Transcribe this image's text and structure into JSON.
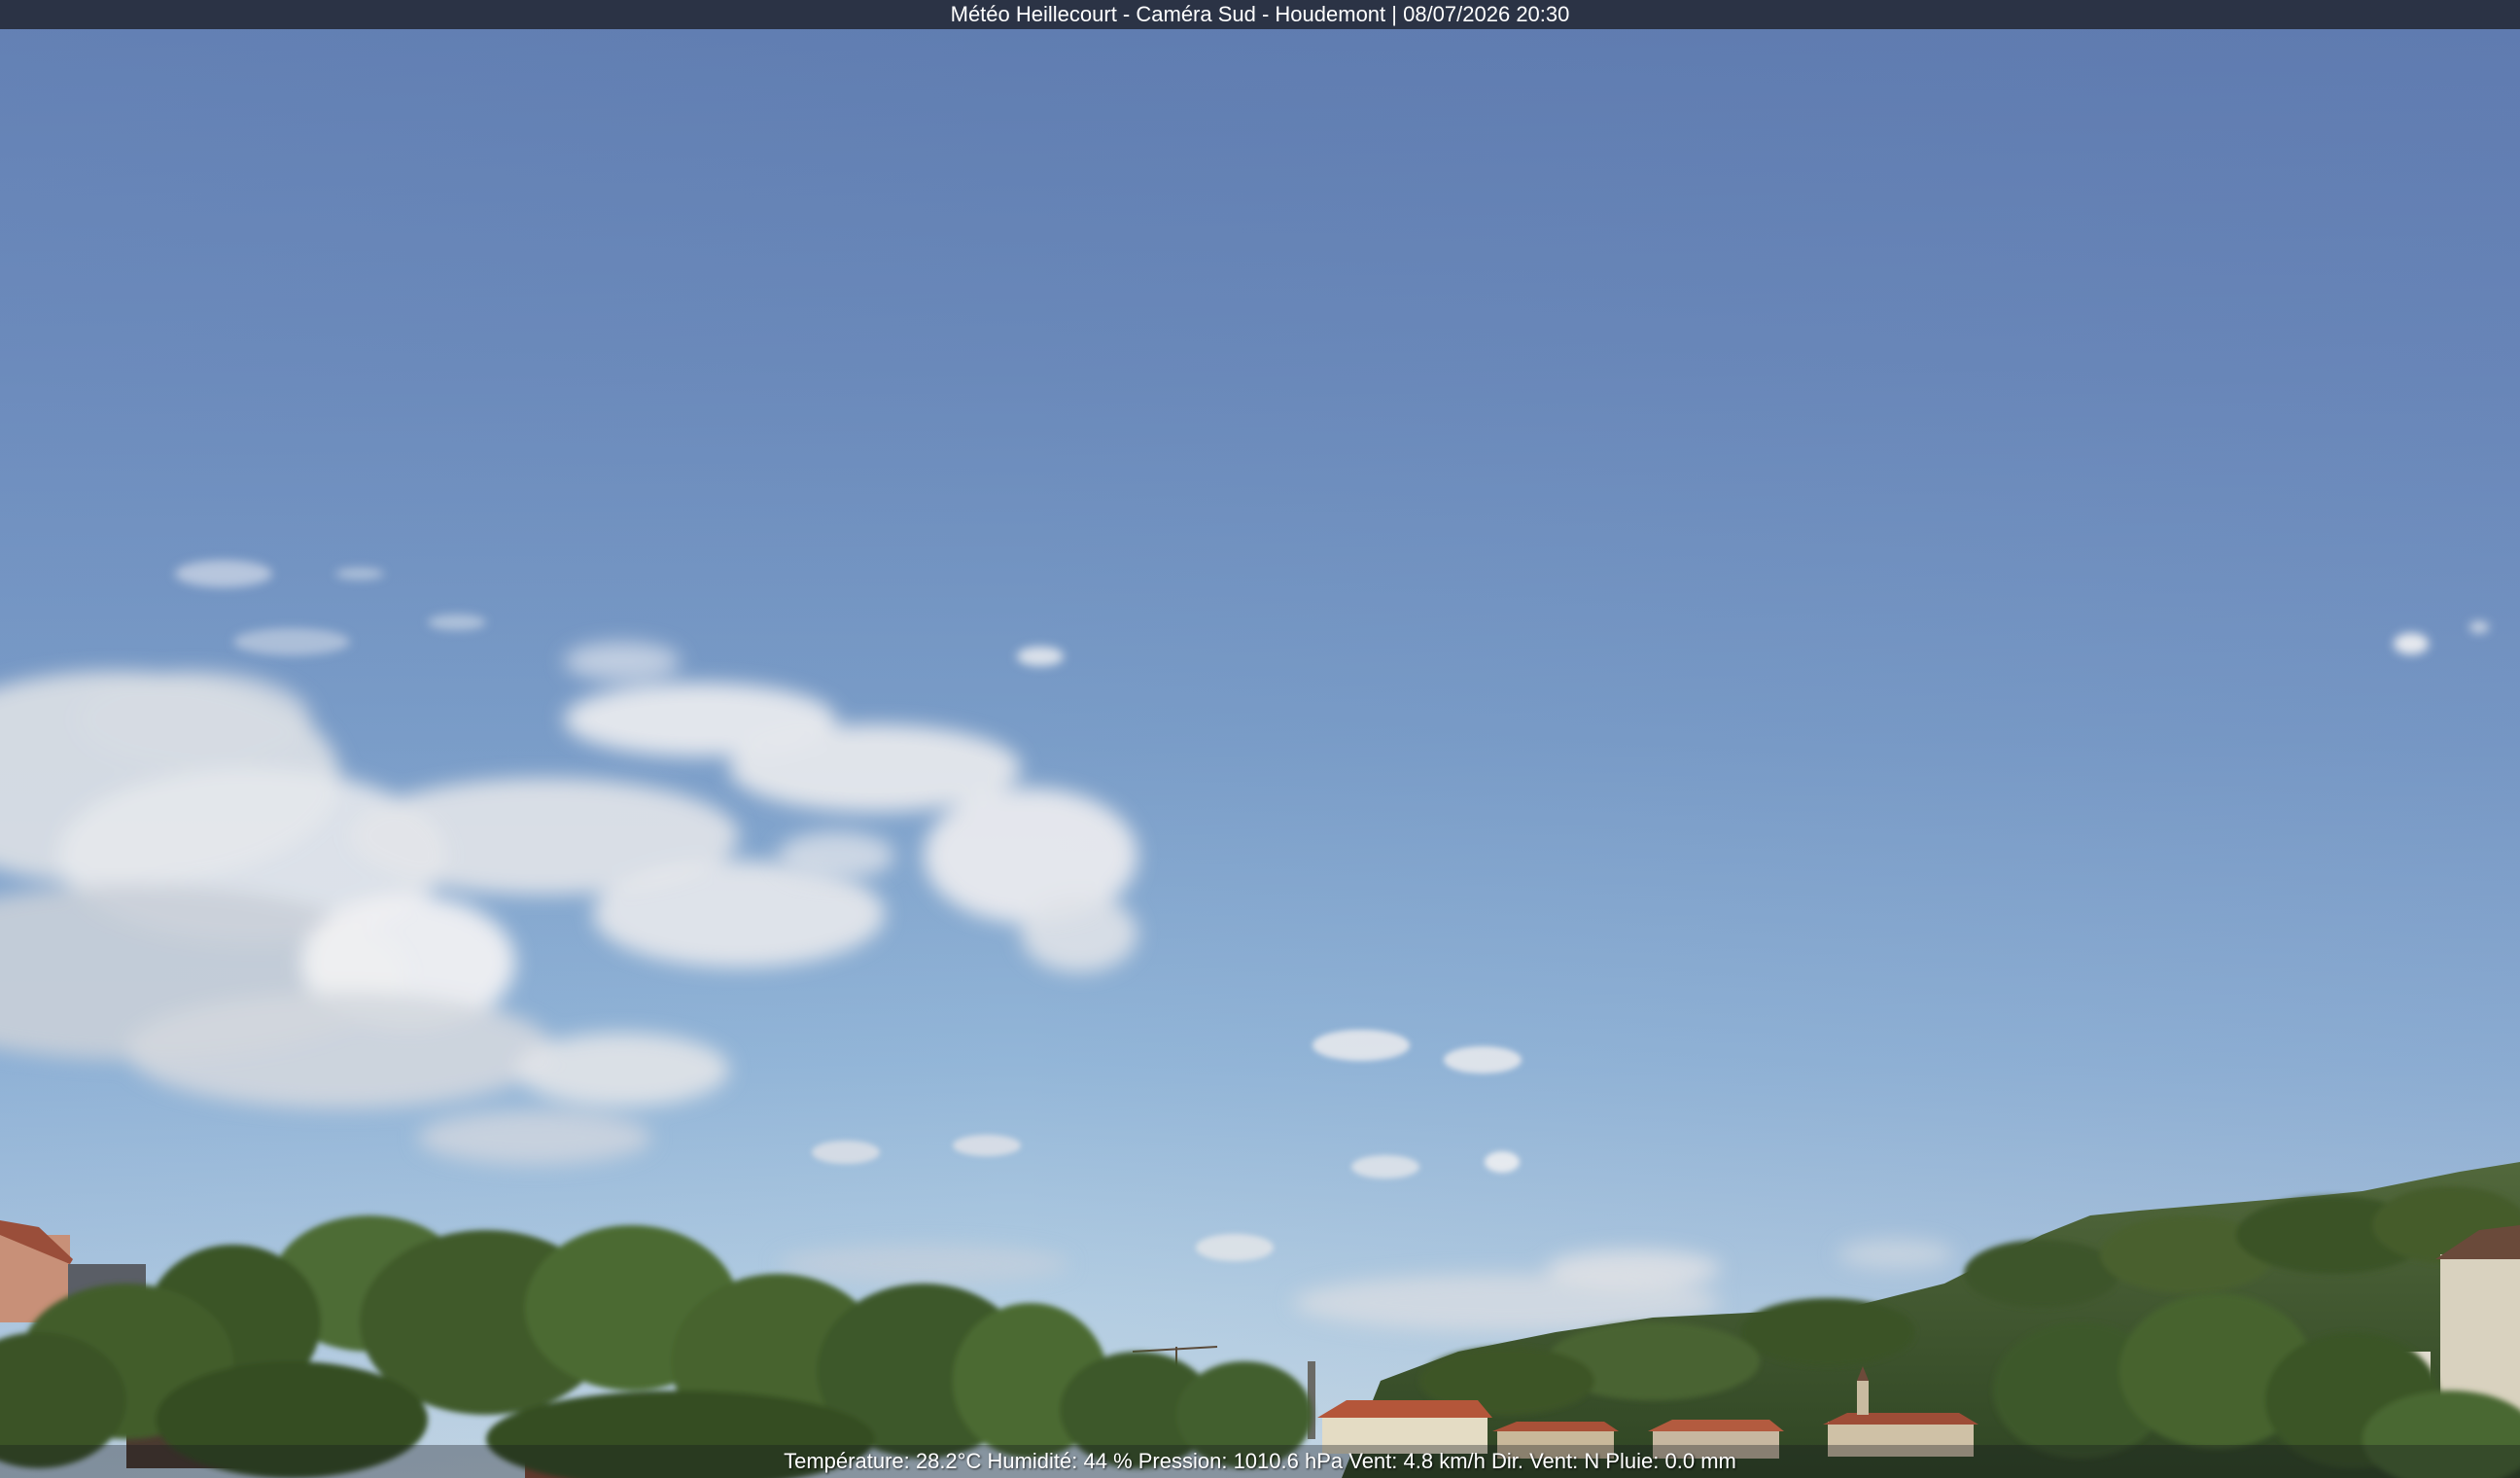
{
  "overlay": {
    "title": "Météo Heillecourt - Caméra Sud - Houdemont | 08/07/2026 20:30",
    "weather_readout": "Température: 28.2°C  Humidité: 44 % Pression: 1010.6 hPa Vent: 4.8 km/h Dir. Vent: N Pluie: 0.0 mm"
  },
  "colors": {
    "title_bar": "#2b3345",
    "sky_top": "#5f7cb0",
    "sky_horizon": "#c7d9e6",
    "trees": "#3f5a2a",
    "hill": "#4a6234",
    "roof": "#b4563a"
  }
}
